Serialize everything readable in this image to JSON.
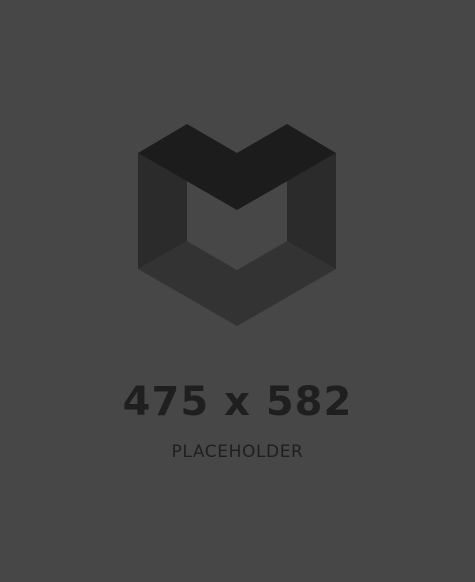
{
  "placeholder": {
    "dimensions_text": "475 x 582",
    "caption": "PLACEHOLDER",
    "background_color": "#474747",
    "text_color": "#1f1f1f"
  },
  "logo": {
    "icon": "placeholder-cube-icon",
    "colors": {
      "top_face": "#1c1c1c",
      "side_faces": "#2b2b2b",
      "bottom_face": "#333333",
      "inner": "#474747"
    }
  }
}
